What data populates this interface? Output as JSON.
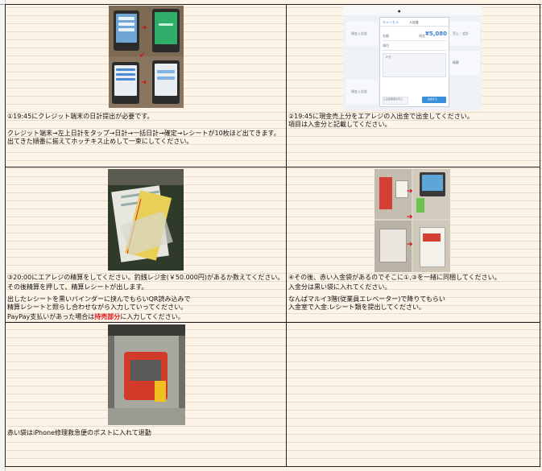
{
  "cells": {
    "c1": {
      "line1": "①19:45にクレジット端末の日計提出が必要です。",
      "line2": "クレジット端末→左上日計をタップ→日計→一括日計→確定→レシートが10枚ほど出てきます。",
      "line3": "出てきた順番に揃えてホッチキス止めして一束にしてください。"
    },
    "c2": {
      "line1": "②19:45に現金売上分をエアレジの入出金で出金してください。",
      "line2": "項目は入金分と記載してください。"
    },
    "c3": {
      "line1": "③20:00にエアレジの精算をしてください。釣銭レジ金(￥50.000円)があるか数えてください。",
      "line2": "その後精算を押して、精算レシートが出します。",
      "line3": "出したレシートを黒いバインダーに挟んでもらいQR読み込みで",
      "line4": "精算レシートと照らし合わせながら入力していってください。",
      "line5_pre": "PayPay支払いがあった場合は",
      "line5_red": "持売部分",
      "line5_post": "に入力してください。"
    },
    "c4": {
      "line1": "④その後、赤い入金袋があるのでそこに①,③を一緒に同梱してください。",
      "line2": "入金分は黒い袋に入れてください。",
      "line3": "なんばマルイ3階(従業員エレベーター)で降りてもらい",
      "line4": "入金室で入金.レシート類を提出してください。"
    },
    "c5": {
      "line1": "赤い袋はiPhone修理救急便のポストに入れて退勤"
    }
  },
  "ipad": {
    "amount": "¥5,080",
    "amount_prefix": "現金",
    "modal_title": "入出金",
    "tab_left": "キャンセル",
    "row_label_1": "金額",
    "row_label_2": "項目",
    "row_label_3": "メモ",
    "button_left": "入出金履歴を見る",
    "button_right": "出金する",
    "bg_label_1": "現金入出金",
    "bg_label_2": "売上・会計",
    "bg_label_3": "精算",
    "bg_label_4": "現金入出金"
  },
  "colors": {
    "sheet_bg": "#fdf3e6",
    "grid_line": "#222222",
    "highlight_red": "#e01b1b",
    "ipad_accent": "#3a8fdc"
  }
}
